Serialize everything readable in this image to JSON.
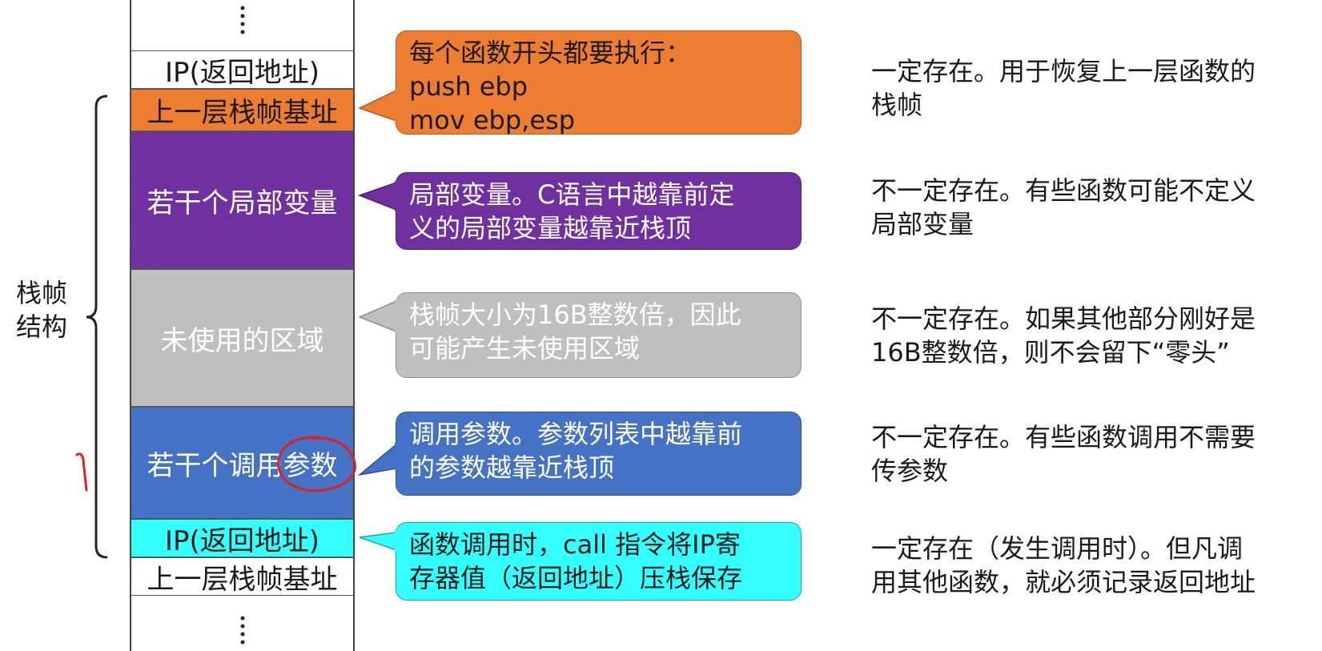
{
  "brace_label": "栈帧结构",
  "brace_label_lines": [
    "栈帧",
    "结构"
  ],
  "stack": [
    {
      "id": "top-ip",
      "label": "IP(返回地址)",
      "bg": "#ffffff",
      "fg": "#1a1a1a"
    },
    {
      "id": "prev-base",
      "label": "上一层栈帧基址",
      "bg": "#ED7D31",
      "fg": "#1a1a1a"
    },
    {
      "id": "locals",
      "label": "若干个局部变量",
      "bg": "#7030A0",
      "fg": "#ffffff"
    },
    {
      "id": "unused",
      "label": "未使用的区域",
      "bg": "#BFBFBF",
      "fg": "#ffffff"
    },
    {
      "id": "params",
      "label": "若干个调用参数",
      "bg": "#4472C4",
      "fg": "#ffffff"
    },
    {
      "id": "ret-ip",
      "label": "IP(返回地址)",
      "bg": "#33FFFF",
      "fg": "#1a1a1a"
    },
    {
      "id": "bottom-base",
      "label": "上一层栈帧基址",
      "bg": "#ffffff",
      "fg": "#1a1a1a"
    }
  ],
  "callouts": [
    {
      "lines": [
        "每个函数开头都要执行：",
        "push ebp",
        "mov ebp,esp"
      ],
      "bg": "#ED7D31",
      "fg": "#1a1a1a"
    },
    {
      "lines": [
        "局部变量。C语言中越靠前定",
        "义的局部变量越靠近栈顶"
      ],
      "bg": "#7030A0",
      "fg": "#ffffff"
    },
    {
      "lines": [
        "栈帧大小为16B整数倍，因此",
        "可能产生未使用区域"
      ],
      "bg": "#BFBFBF",
      "fg": "#ffffff"
    },
    {
      "lines": [
        "调用参数。参数列表中越靠前",
        "的参数越靠近栈顶"
      ],
      "bg": "#4472C4",
      "fg": "#ffffff"
    },
    {
      "lines": [
        "函数调用时，call 指令将IP寄",
        "存器值（返回地址）压栈保存"
      ],
      "bg": "#33FFFF",
      "fg": "#1a1a1a"
    }
  ],
  "notes": [
    {
      "lines": [
        "一定存在。用于恢复上一层函数的",
        "栈帧"
      ]
    },
    {
      "lines": [
        "不一定存在。有些函数可能不定义",
        "局部变量"
      ]
    },
    {
      "lines": [
        "不一定存在。如果其他部分刚好是",
        "16B整数倍，则不会留下“零头”"
      ]
    },
    {
      "lines": [
        "不一定存在。有些函数调用不需要",
        "传参数"
      ]
    },
    {
      "lines": [
        "一定存在（发生调用时）。但凡调",
        "用其他函数，就必须记录返回地址"
      ]
    }
  ],
  "annotation_color": "#E02020"
}
